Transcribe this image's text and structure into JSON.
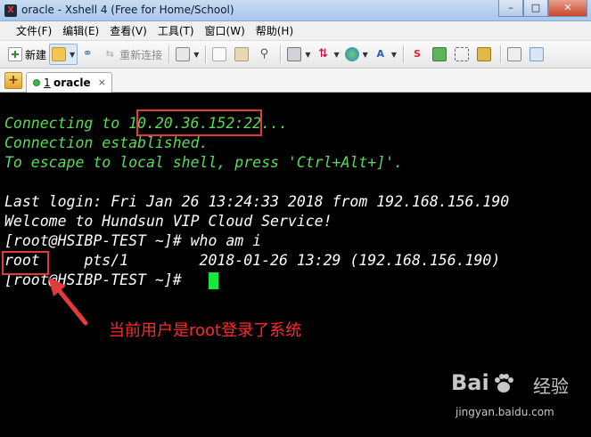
{
  "window": {
    "title": "oracle - Xshell 4 (Free for Home/School)",
    "app_icon": "xshell-icon",
    "controls": {
      "minimize": "–",
      "maximize": "□",
      "close": "✕"
    }
  },
  "menu": {
    "items": [
      "文件(F)",
      "编辑(E)",
      "查看(V)",
      "工具(T)",
      "窗口(W)",
      "帮助(H)"
    ]
  },
  "toolbar": {
    "new_label": "新建",
    "reconnect_label": "重新连接"
  },
  "tabs": {
    "add_symbol": "+",
    "items": [
      {
        "index": "1",
        "label": "oracle",
        "close": "×",
        "status_color": "#3fb33f"
      }
    ]
  },
  "terminal": {
    "lines": [
      {
        "text": "Connecting to 10.20.36.152:22...",
        "color": "#5ad95a"
      },
      {
        "text": "Connection established.",
        "color": "#5ad95a"
      },
      {
        "text": "To escape to local shell, press 'Ctrl+Alt+]'.",
        "color": "#5ad95a"
      },
      {
        "text": "",
        "color": "#ffffff"
      },
      {
        "text": "Last login: Fri Jan 26 13:24:33 2018 from 192.168.156.190",
        "color": "#ffffff"
      },
      {
        "text": "Welcome to Hundsun VIP Cloud Service!",
        "color": "#ffffff"
      },
      {
        "text": "[root@HSIBP-TEST ~]# who am i",
        "color": "#ffffff"
      },
      {
        "text": "root     pts/1        2018-01-26 13:29 (192.168.156.190)",
        "color": "#ffffff"
      },
      {
        "text": "[root@HSIBP-TEST ~]# ",
        "color": "#ffffff"
      }
    ],
    "cursor_color": "#16e83a"
  },
  "annotation": {
    "text": "当前用户是root登录了系统",
    "color": "#ff2a2a"
  },
  "watermark": {
    "logo_left": "Bai",
    "logo_right": "经验",
    "url": "jingyan.baidu.com"
  }
}
